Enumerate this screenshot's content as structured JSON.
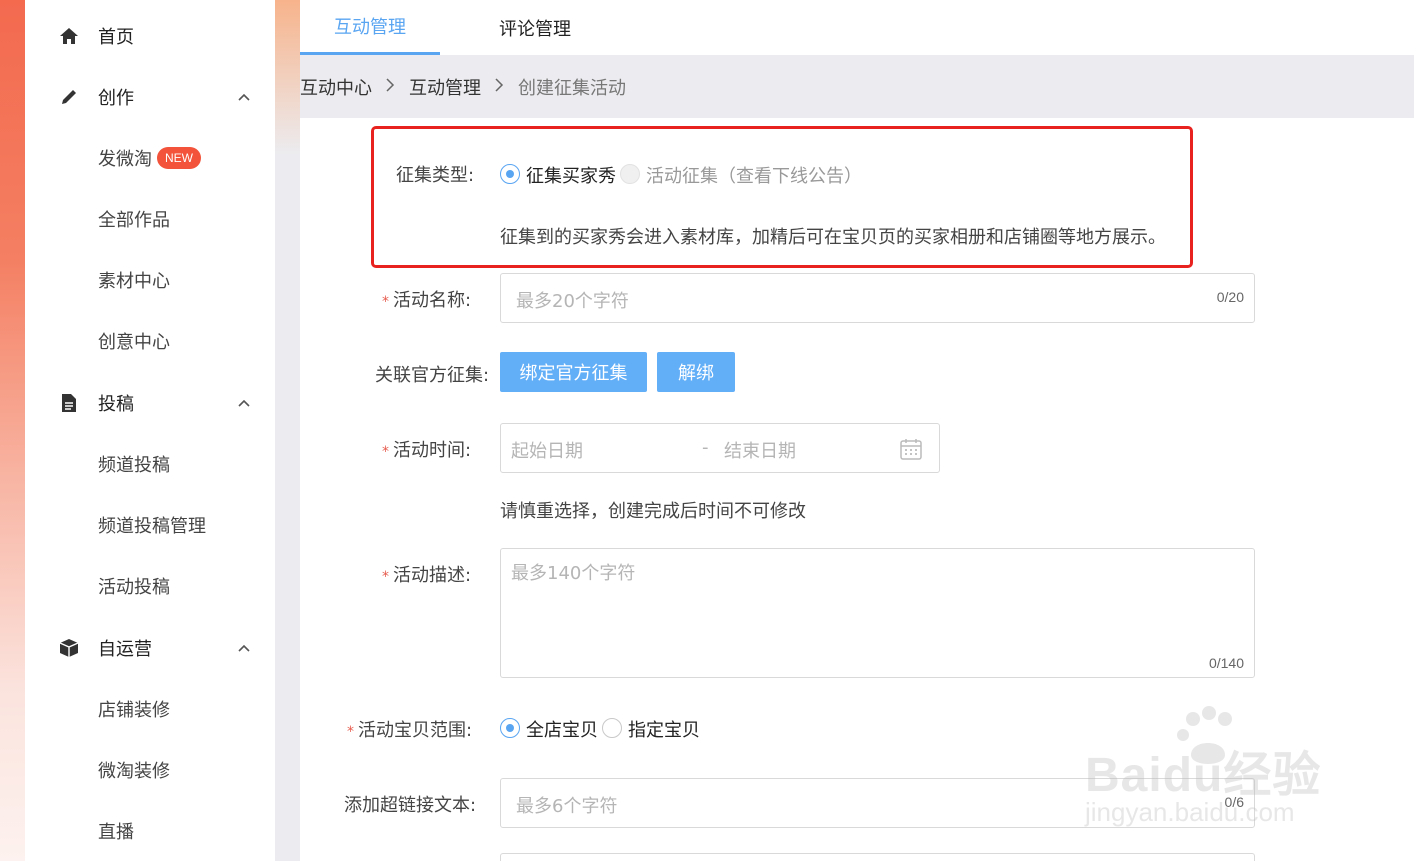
{
  "sidebar": {
    "items": [
      {
        "label": "首页",
        "icon": "home-icon"
      },
      {
        "label": "创作",
        "icon": "pencil-icon"
      },
      {
        "label": "发微淘",
        "badge": "NEW"
      },
      {
        "label": "全部作品"
      },
      {
        "label": "素材中心"
      },
      {
        "label": "创意中心"
      },
      {
        "label": "投稿",
        "icon": "document-icon"
      },
      {
        "label": "频道投稿"
      },
      {
        "label": "频道投稿管理"
      },
      {
        "label": "活动投稿"
      },
      {
        "label": "自运营",
        "icon": "box-icon"
      },
      {
        "label": "店铺装修"
      },
      {
        "label": "微淘装修"
      },
      {
        "label": "直播"
      }
    ]
  },
  "tabs": [
    {
      "label": "互动管理",
      "active": true
    },
    {
      "label": "评论管理",
      "active": false
    }
  ],
  "breadcrumb": [
    "互动中心",
    "互动管理",
    "创建征集活动"
  ],
  "form": {
    "collect_type": {
      "label": "征集类型:",
      "options": [
        {
          "label": "征集买家秀",
          "checked": true
        },
        {
          "label": "活动征集（查看下线公告）",
          "disabled": true
        }
      ],
      "hint": "征集到的买家秀会进入素材库，加精后可在宝贝页的买家相册和店铺圈等地方展示。"
    },
    "activity_name": {
      "label": "活动名称:",
      "placeholder": "最多20个字符",
      "counter": "0/20"
    },
    "official": {
      "label": "关联官方征集:",
      "bind_button": "绑定官方征集",
      "unbind_button": "解绑"
    },
    "activity_time": {
      "label": "活动时间:",
      "start_placeholder": "起始日期",
      "separator": "-",
      "end_placeholder": "结束日期",
      "hint": "请慎重选择，创建完成后时间不可修改"
    },
    "description": {
      "label": "活动描述:",
      "placeholder": "最多140个字符",
      "counter": "0/140"
    },
    "scope": {
      "label": "活动宝贝范围:",
      "options": [
        {
          "label": "全店宝贝",
          "checked": true
        },
        {
          "label": "指定宝贝",
          "checked": false
        }
      ]
    },
    "link_text": {
      "label": "添加超链接文本:",
      "placeholder": "最多6个字符",
      "counter": "0/6"
    }
  },
  "watermark": {
    "text": "Baidu经验",
    "sub": "jingyan.baidu.com"
  },
  "colors": {
    "accent": "#5aa5f2",
    "button": "#62aef7",
    "highlight": "#e8221e",
    "required": "#e65c4e",
    "badge": "#f2533a"
  }
}
